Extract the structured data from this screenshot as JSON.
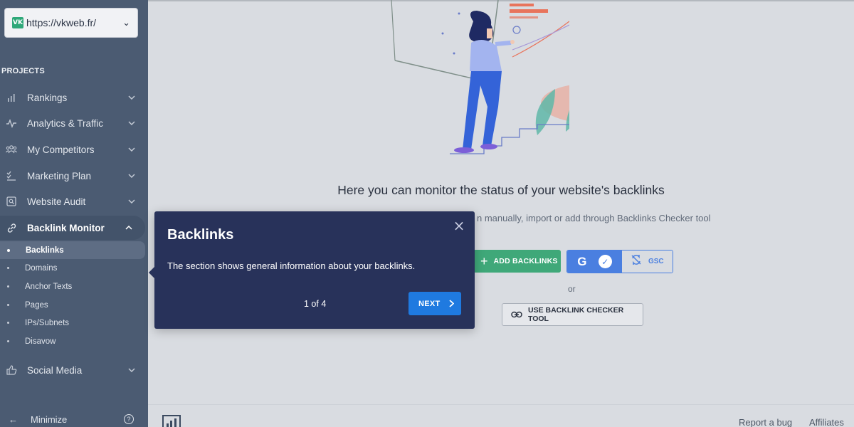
{
  "project": {
    "logo_text": "VK",
    "url": "https://vkweb.fr/"
  },
  "sidebar": {
    "section_label": "PROJECTS",
    "items": [
      {
        "label": "Rankings",
        "icon": "bar-chart-icon"
      },
      {
        "label": "Analytics & Traffic",
        "icon": "pulse-icon"
      },
      {
        "label": "My Competitors",
        "icon": "people-icon"
      },
      {
        "label": "Marketing Plan",
        "icon": "checklist-icon"
      },
      {
        "label": "Website Audit",
        "icon": "audit-icon"
      },
      {
        "label": "Backlink Monitor",
        "icon": "link-icon",
        "active": true
      },
      {
        "label": "Social Media",
        "icon": "thumbs-up-icon"
      }
    ],
    "subitems": [
      {
        "label": "Backlinks",
        "active": true
      },
      {
        "label": "Domains"
      },
      {
        "label": "Anchor Texts"
      },
      {
        "label": "Pages"
      },
      {
        "label": "IPs/Subnets"
      },
      {
        "label": "Disavow"
      }
    ],
    "minimize_label": "Minimize",
    "help_glyph": "?"
  },
  "main": {
    "heading": "Here you can monitor the status of your website's backlinks",
    "subtext": "n manually, import or add through Backlinks Checker tool",
    "add_button": "ADD BACKLINKS",
    "gsc_g": "G",
    "gsc_label": "GSC",
    "or_text": "or",
    "checker_button": "USE BACKLINK CHECKER TOOL"
  },
  "tooltip": {
    "title": "Backlinks",
    "body": "The section shows general information about your backlinks.",
    "steps": "1 of 4",
    "next_label": "NEXT",
    "close_glyph": "×"
  },
  "footer": {
    "report_bug": "Report a bug",
    "affiliates": "Affiliates"
  },
  "colors": {
    "sidebar_bg": "#4b5b72",
    "tooltip_bg": "#28325a",
    "primary_blue": "#1f7ae0",
    "green": "#3fa879",
    "gsc_blue": "#4a7fe0"
  }
}
